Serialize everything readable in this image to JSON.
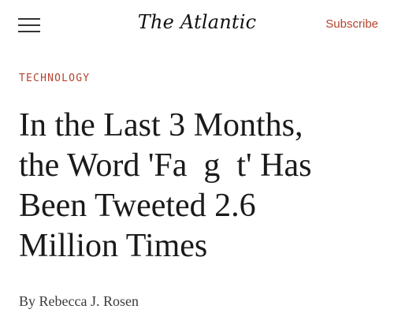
{
  "header": {
    "menu_icon": "hamburger-menu-icon",
    "logo_text": "The Atlantic",
    "subscribe_label": "Subscribe"
  },
  "article": {
    "section": "TECHNOLOGY",
    "headline_lines": [
      "In the Last 3 Months,",
      "the Word 'Fa  g  t' Has",
      "Been Tweeted 2.6",
      "Million Times"
    ],
    "byline_prefix": "By",
    "author": "Rebecca J. Rosen"
  },
  "colors": {
    "accent": "#b5422e",
    "text": "#1a1a1a",
    "background": "#ffffff"
  }
}
